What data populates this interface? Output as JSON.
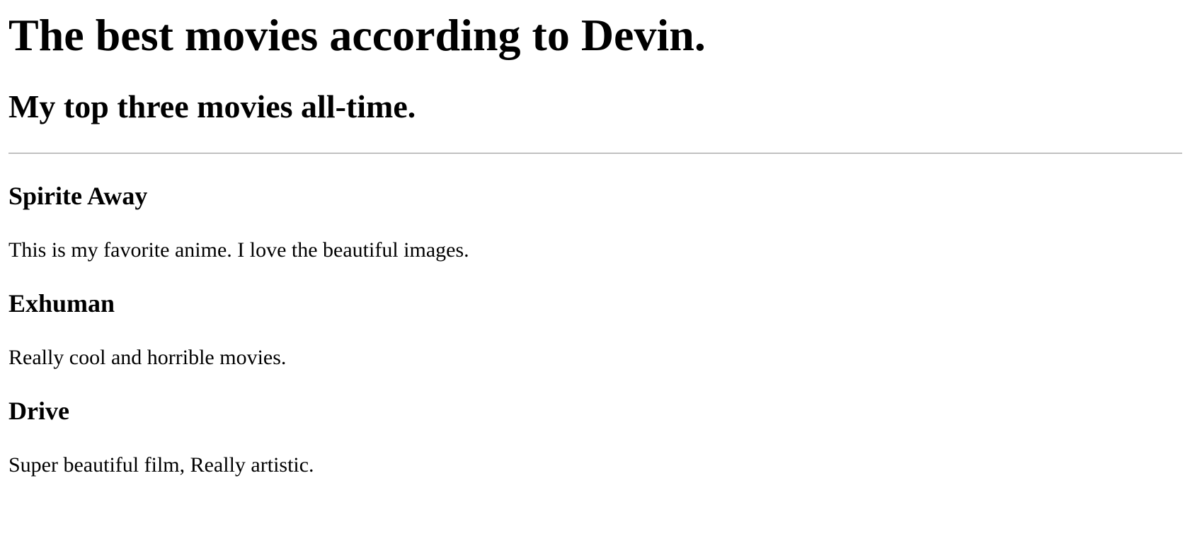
{
  "page": {
    "title": "The best movies according to Devin.",
    "subtitle": "My top three movies all-time."
  },
  "movies": [
    {
      "title": "Spirite Away",
      "description": "This is my favorite anime. I love the beautiful images."
    },
    {
      "title": "Exhuman",
      "description": "Really cool and horrible movies."
    },
    {
      "title": "Drive",
      "description": "Super beautiful film, Really artistic."
    }
  ]
}
